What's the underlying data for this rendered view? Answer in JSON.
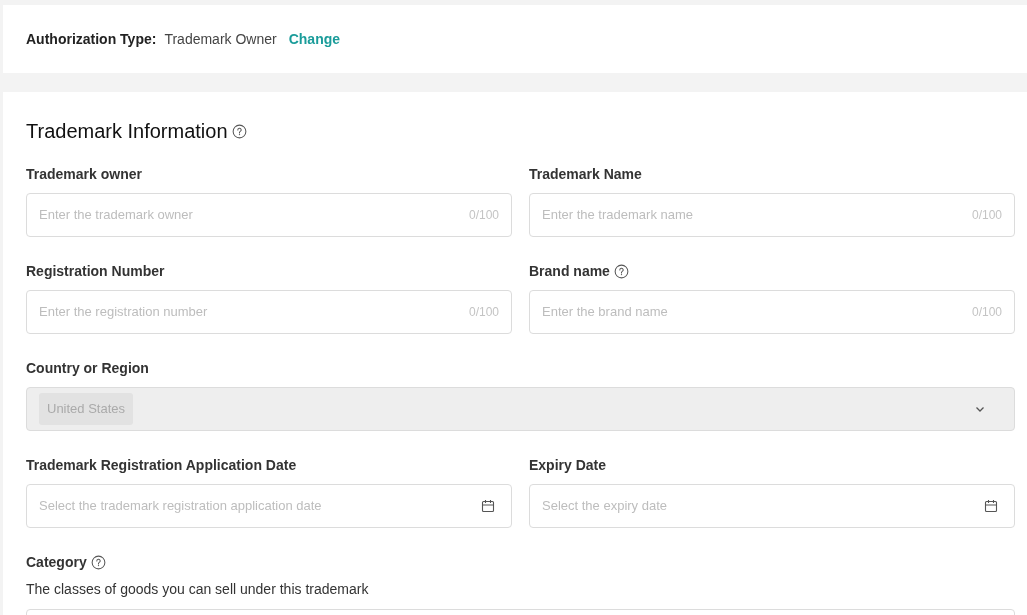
{
  "authorization": {
    "label": "Authorization Type:",
    "value": "Trademark Owner",
    "link": "Change"
  },
  "section": {
    "title": "Trademark Information",
    "help": true
  },
  "fields": [
    {
      "kind": "text",
      "label": "Trademark owner",
      "help": false,
      "placeholder": "Enter the trademark owner",
      "counter": "0/100"
    },
    {
      "kind": "text",
      "label": "Trademark Name",
      "help": false,
      "placeholder": "Enter the trademark name",
      "counter": "0/100"
    },
    {
      "kind": "text",
      "label": "Registration Number",
      "help": false,
      "placeholder": "Enter the registration number",
      "counter": "0/100"
    },
    {
      "kind": "text",
      "label": "Brand name",
      "help": true,
      "placeholder": "Enter the brand name",
      "counter": "0/100"
    },
    {
      "kind": "select",
      "label": "Country or Region",
      "help": false,
      "value": "United States",
      "disabled": true
    },
    {
      "kind": "date",
      "label": "Trademark Registration Application Date",
      "help": false,
      "placeholder": "Select the trademark registration application date"
    },
    {
      "kind": "date",
      "label": "Expiry Date",
      "help": false,
      "placeholder": "Select the expiry date"
    }
  ],
  "category": {
    "label": "Category",
    "help": true,
    "description": "The classes of goods you can sell under this trademark"
  }
}
